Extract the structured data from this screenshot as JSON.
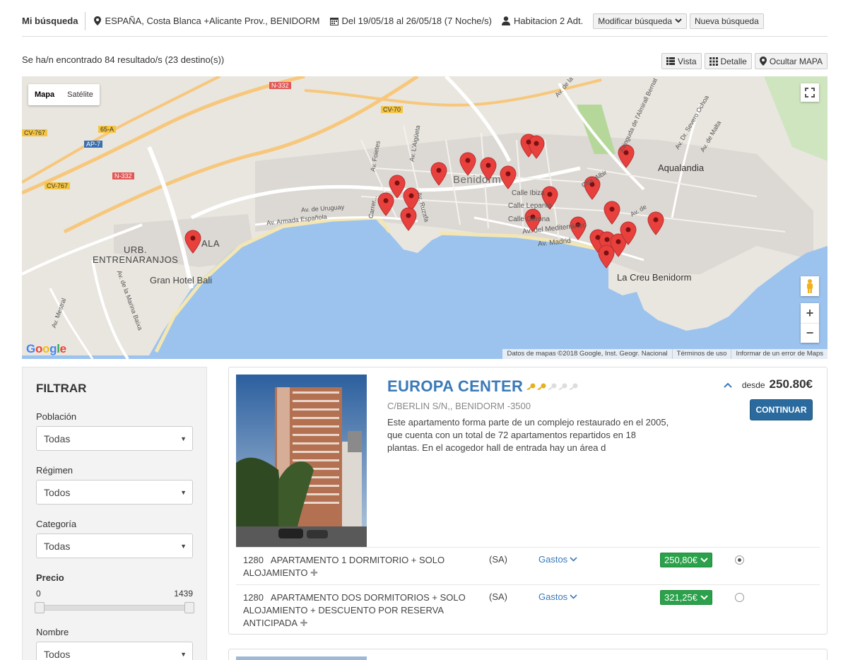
{
  "search": {
    "title": "Mi búsqueda",
    "destination": "ESPAÑA, Costa Blanca +Alicante Prov., BENIDORM",
    "dates": "Del 19/05/18 al 26/05/18 (7 Noche/s)",
    "rooms": "Habitacion 2 Adt.",
    "modify_label": "Modificar búsqueda",
    "new_label": "Nueva búsqueda"
  },
  "results": {
    "summary": "Se ha/n encontrado 84 resultado/s (23 destino(s))",
    "view_label": "Vista",
    "detail_label": "Detalle",
    "hide_map_label": "Ocultar MAPA"
  },
  "map": {
    "type_map": "Mapa",
    "type_satellite": "Satélite",
    "labels": {
      "benidorm": "Benidorm",
      "aqualandia": "Aqualandia",
      "la_creu": "La Creu Benidorm",
      "urb": "URB.",
      "entrenaranjos": "ENTRENARANJOS",
      "ala": "ALA",
      "gran_hotel": "Gran Hotel Bali",
      "av_mestral": "Av. Mestral",
      "av_marina": "Av. de la Marina Baixa",
      "av_armada": "Av. Armada Española",
      "av_uruguay": "Av. de Uruguay",
      "av_foietes": "Av. Foietes",
      "av_aigueta": "Av. L'Aigüeta",
      "av_ruzafa": "Av. Ruzafa",
      "carrer": "Carrer...",
      "calle_ibiza": "Calle Ibiza",
      "calle_lepanto": "Calle Lepanto",
      "calle_gerona": "Calle Gerona",
      "av_med": "Av. del Mediterráneo",
      "av_madrid": "Av. Madrid",
      "av_almirall": "Avinguda de l'Almirall Bernat",
      "av_severo": "Av. Dr. Severo Ochoa",
      "av_malta": "Av. de Malta",
      "ctra_albir": "Ctra. Albir",
      "av_de": "Av. de",
      "av_la": "Av. de la"
    },
    "road_badges": {
      "n332a": "N-332",
      "cv70": "CV-70",
      "cv767a": "CV-767",
      "sixfive": "65-A",
      "ap7": "AP-7",
      "n332b": "N-332",
      "cv767b": "CV-767"
    },
    "footer_data": "Datos de mapas ©2018 Google, Inst. Geogr. Nacional",
    "footer_terms": "Términos de uso",
    "footer_report": "Informar de un error de Maps",
    "google": "Google"
  },
  "filter": {
    "title": "FILTRAR",
    "poblacion_label": "Población",
    "poblacion_value": "Todas",
    "regimen_label": "Régimen",
    "regimen_value": "Todos",
    "categoria_label": "Categoría",
    "categoria_value": "Todas",
    "precio_label": "Precio",
    "precio_min": "0",
    "precio_max": "1439",
    "nombre_label": "Nombre",
    "nombre_value": "Todos"
  },
  "hotel": {
    "name": "EUROPA CENTER",
    "keys_filled": 2,
    "keys_total": 5,
    "address": "C/BERLIN S/N,, BENIDORM -3500",
    "description": "Este apartamento forma parte de un complejo restaurado en el 2005, que cuenta con un total de 72 apartamentos repartidos en 18 plantas. En el acogedor hall de entrada hay un área d",
    "desde": "desde",
    "price": "250.80€",
    "continue_label": "CONTINUAR",
    "rooms": [
      {
        "code": "1280",
        "name": "APARTAMENTO 1 DORMITORIO + SOLO ALOJAMIENTO",
        "regimen": "(SA)",
        "gastos": "Gastos",
        "price": "250,80€",
        "selected": true
      },
      {
        "code": "1280",
        "name": "APARTAMENTO DOS DORMITORIOS + SOLO ALOJAMIENTO + DESCUENTO POR RESERVA ANTICIPADA",
        "regimen": "(SA)",
        "gastos": "Gastos",
        "price": "321,25€",
        "selected": false
      }
    ]
  },
  "colors": {
    "link_blue": "#3a7ab8",
    "button_blue": "#2a6a9e",
    "price_green": "#2aa14a",
    "marker_red": "#e8413d",
    "sea": "#9cc3ee"
  }
}
